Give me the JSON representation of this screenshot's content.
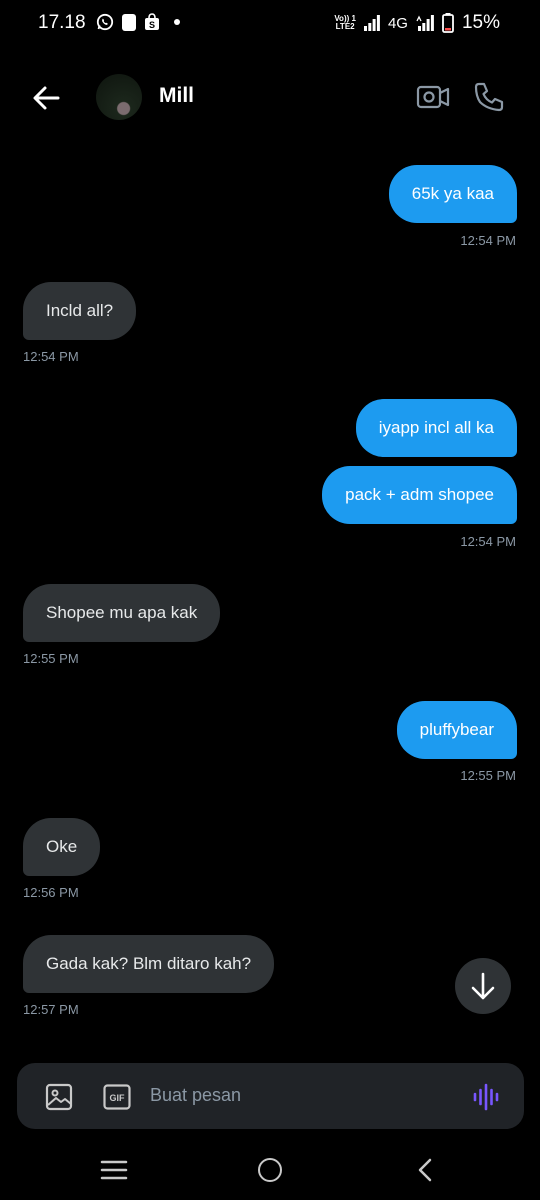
{
  "status_bar": {
    "time": "17.18",
    "network_top": "Vo)) 1",
    "network_bottom": "LTE2",
    "network_type": "4G",
    "battery": "15%",
    "icons": [
      "whatsapp-icon",
      "notification-icon",
      "shopee-icon",
      "dot-icon",
      "signal-icon",
      "battery-icon"
    ]
  },
  "header": {
    "contact_name": "Mill",
    "back_icon": "arrow-left-icon",
    "video_icon": "video-camera-icon",
    "call_icon": "phone-icon"
  },
  "messages": [
    {
      "side": "out",
      "text": "65k ya kaa",
      "time": "12:54 PM"
    },
    {
      "side": "in",
      "text": "Incld all?",
      "time": "12:54 PM"
    },
    {
      "side": "out",
      "text": "iyapp incl all ka",
      "time": ""
    },
    {
      "side": "out",
      "text": "pack + adm shopee",
      "time": "12:54 PM"
    },
    {
      "side": "in",
      "text": "Shopee mu apa kak",
      "time": "12:55 PM"
    },
    {
      "side": "out",
      "text": "pluffybear",
      "time": "12:55 PM"
    },
    {
      "side": "in",
      "text": "Oke",
      "time": "12:56 PM"
    },
    {
      "side": "in",
      "text": "Gada kak? Blm ditaro kah?",
      "time": "12:57 PM"
    }
  ],
  "composer": {
    "placeholder": "Buat pesan",
    "gif_label": "GIF"
  },
  "colors": {
    "outgoing_bubble": "#1d9bf0",
    "incoming_bubble": "#2f3336",
    "background": "#000000",
    "voice_accent": "#7856ff"
  }
}
